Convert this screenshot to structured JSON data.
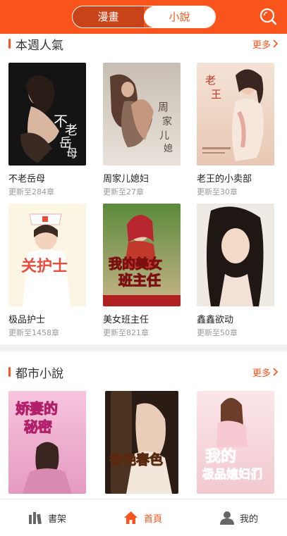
{
  "header": {
    "tabs": [
      {
        "label": "漫畫",
        "active": false
      },
      {
        "label": "小說",
        "active": true
      }
    ],
    "search_icon": "search-icon",
    "accent_color": "#f8541c"
  },
  "sections": [
    {
      "title": "本週人氣",
      "more_label": "更多",
      "books": [
        {
          "title": "不老岳母",
          "update": "更新至284章",
          "cover_text": "不老岳母"
        },
        {
          "title": "周家儿媳妇",
          "update": "更新至27章",
          "cover_text": "周家儿媳妇"
        },
        {
          "title": "老王的小卖部",
          "update": "更新至30章",
          "cover_text": "老王"
        },
        {
          "title": "极品护士",
          "update": "更新至1458章",
          "cover_text": "关护士"
        },
        {
          "title": "美女班主任",
          "update": "更新至821章",
          "cover_text": "我的美女班主任"
        },
        {
          "title": "鑫鑫欲动",
          "update": "更新至50章",
          "cover_text": ""
        }
      ]
    },
    {
      "title": "都市小說",
      "more_label": "更多",
      "books": [
        {
          "title": "",
          "update": "",
          "cover_text": "娇妻的秘密"
        },
        {
          "title": "",
          "update": "",
          "cover_text": "香艳春色"
        },
        {
          "title": "",
          "update": "",
          "cover_text": "我的极品媳妇们"
        }
      ]
    }
  ],
  "bottom_nav": [
    {
      "label": "書架",
      "icon": "bookshelf-icon",
      "active": false
    },
    {
      "label": "首頁",
      "icon": "home-icon",
      "active": true
    },
    {
      "label": "我的",
      "icon": "user-icon",
      "active": false
    }
  ]
}
